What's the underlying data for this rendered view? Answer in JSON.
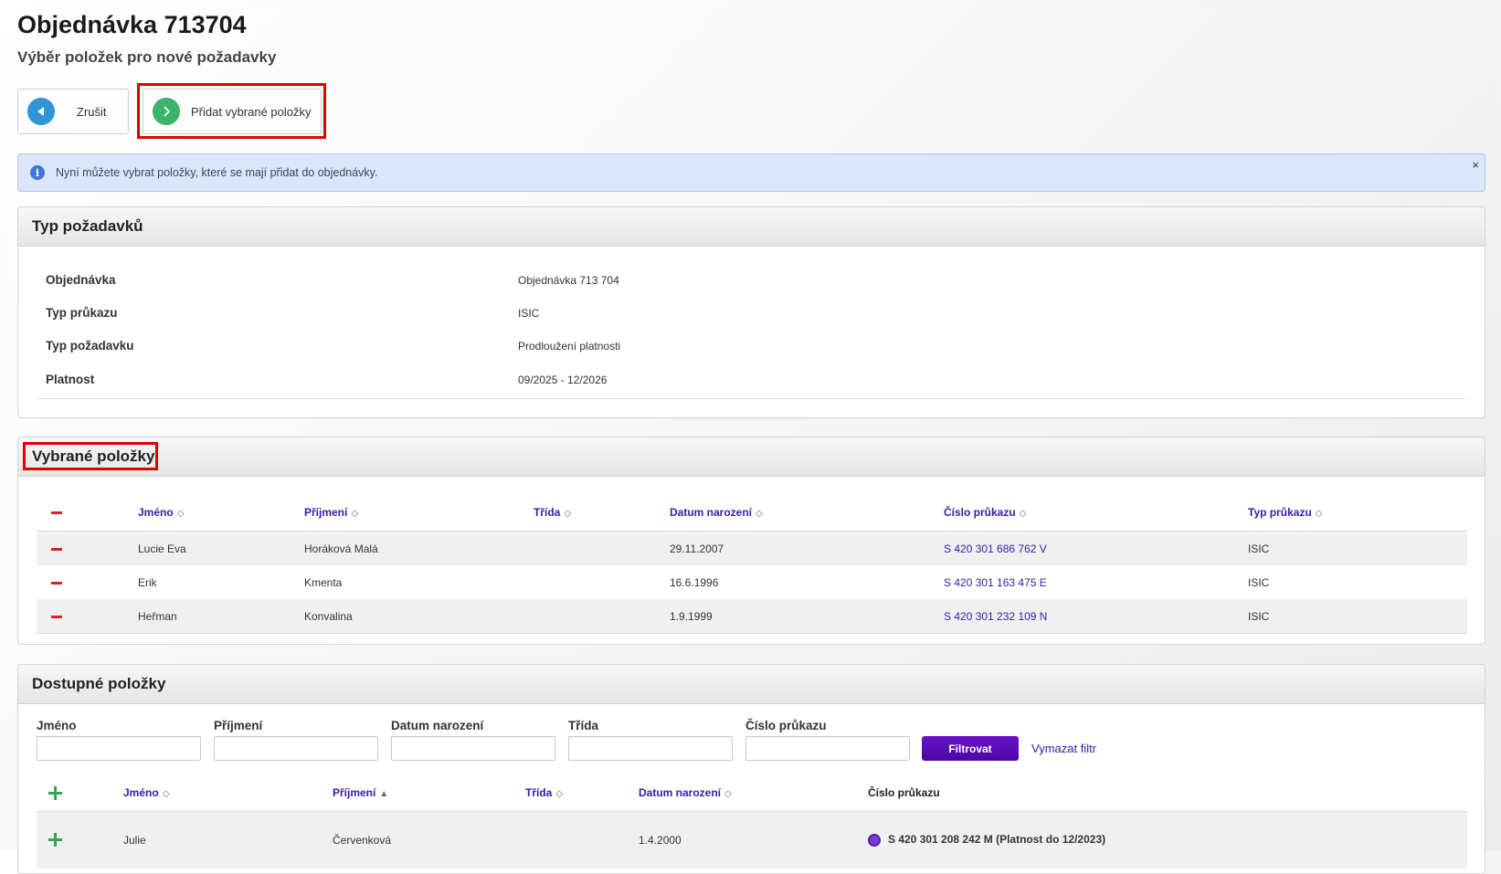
{
  "title": "Objednávka 713704",
  "subtitle": "Výběr položek pro nové požadavky",
  "toolbar": {
    "cancel_label": "Zrušit",
    "add_label": "Přidat vybrané položky"
  },
  "alert": {
    "text": "Nyní můžete vybrat položky, které se mají přidat do objednávky.",
    "close": "×"
  },
  "request_type": {
    "title": "Typ požadavků",
    "rows": [
      {
        "key": "Objednávka",
        "value": "Objednávka 713 704"
      },
      {
        "key": "Typ průkazu",
        "value": "ISIC"
      },
      {
        "key": "Typ požadavku",
        "value": "Prodloužení platnosti"
      },
      {
        "key": "Platnost",
        "value": "09/2025 - 12/2026"
      }
    ]
  },
  "selected": {
    "title": "Vybrané položky",
    "columns": [
      "Jméno",
      "Příjmení",
      "Třída",
      "Datum narození",
      "Číslo průkazu",
      "Typ průkazu"
    ],
    "rows": [
      {
        "first": "Lucie Eva",
        "last": "Horáková Malá",
        "class": "",
        "dob": "29.11.2007",
        "card": "S 420 301 686 762 V",
        "type": "ISIC"
      },
      {
        "first": "Erik",
        "last": "Kmenta",
        "class": "",
        "dob": "16.6.1996",
        "card": "S 420 301 163 475 E",
        "type": "ISIC"
      },
      {
        "first": "Heřman",
        "last": "Konvalina",
        "class": "",
        "dob": "1.9.1999",
        "card": "S 420 301 232 109 N",
        "type": "ISIC"
      }
    ]
  },
  "available": {
    "title": "Dostupné položky",
    "filters": {
      "first": "Jméno",
      "last": "Příjmení",
      "dob": "Datum narození",
      "class": "Třída",
      "card": "Číslo průkazu",
      "button": "Filtrovat",
      "clear": "Vymazat filtr"
    },
    "columns": [
      "Jméno",
      "Příjmení",
      "Třída",
      "Datum narození",
      "Číslo průkazu"
    ],
    "rows": [
      {
        "first": "Julie",
        "last": "Červenková",
        "class": "",
        "dob": "1.4.2000",
        "card": "S 420 301 208 242 M (Platnost do 12/2023)"
      }
    ]
  },
  "colors": {
    "accent": "#3a1aa8",
    "filter_button": "#5a0cb5",
    "minus": "#d2232a",
    "plus": "#2fa84f",
    "highlight": "#e10000"
  }
}
